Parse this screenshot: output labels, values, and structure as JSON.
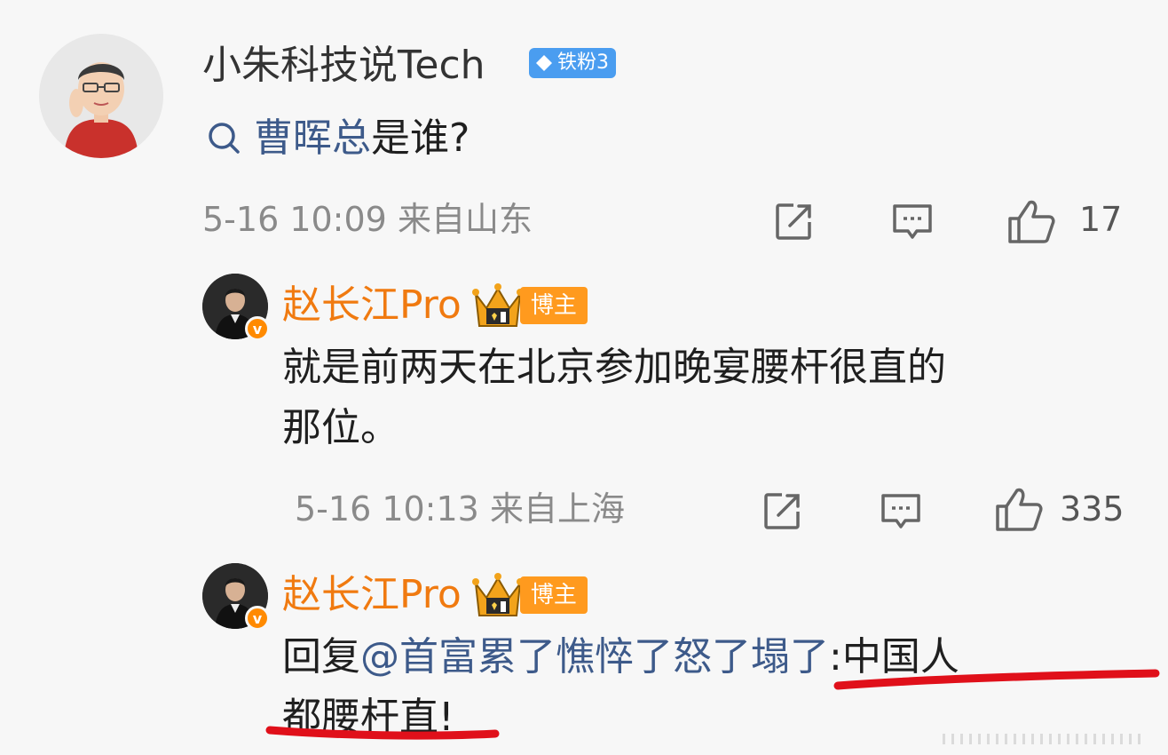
{
  "comment": {
    "username": "小朱科技说Tech",
    "fan_badge": "铁粉3",
    "topic": "曹晖总",
    "text": "是谁?",
    "date": "5-16 10:09",
    "location": "来自山东",
    "likes": "17"
  },
  "replies": [
    {
      "username": "赵长江Pro",
      "badge_label": "博主",
      "text_line1": "就是前两天在北京参加晚宴腰杆很直的",
      "text_line2": "那位。",
      "date": "5-16 10:13",
      "location": "来自上海",
      "likes": "335"
    },
    {
      "username": "赵长江Pro",
      "badge_label": "博主",
      "reply_prefix": "回复",
      "mention": "@首富累了憔悴了怒了塌了",
      "text_rest": ":中国人",
      "text_line2": "都腰杆直!"
    }
  ],
  "icons": [
    "search-icon",
    "share-icon",
    "comment-icon",
    "like-icon",
    "crown-icon",
    "verified-icon",
    "diamond-icon"
  ],
  "colors": {
    "accent_blue": "#3d5a8a",
    "username_orange": "#f07a10",
    "badge_orange": "#ff9a1e",
    "fan_badge_blue": "#4a9df0",
    "annotation_red": "#e0101a"
  }
}
